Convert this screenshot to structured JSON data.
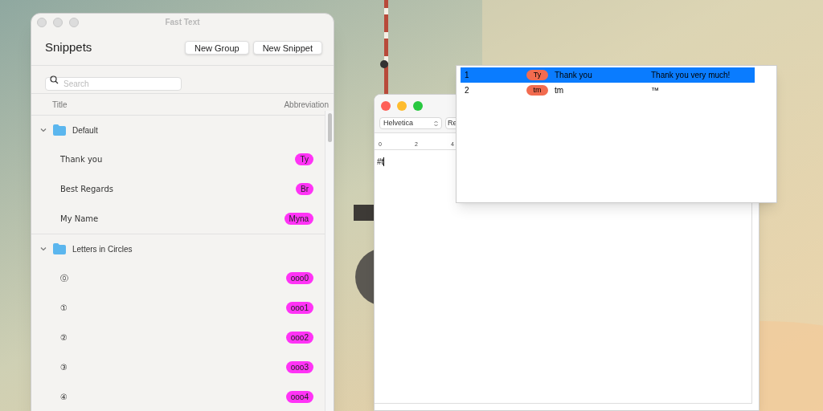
{
  "snippets_window": {
    "title": "Fast Text",
    "heading": "Snippets",
    "buttons": [
      "New Group",
      "New Snippet"
    ],
    "search": {
      "placeholder": "Search"
    },
    "columns": [
      "Title",
      "Abbreviation"
    ],
    "groups": [
      {
        "name": "Default",
        "expanded": true,
        "children": [
          {
            "title": "Thank you",
            "abbreviation": "Ty"
          },
          {
            "title": "Best Regards",
            "abbreviation": "Br"
          },
          {
            "title": "My Name",
            "abbreviation": "Myna"
          }
        ]
      },
      {
        "name": "Letters in Circles",
        "expanded": true,
        "children": [
          {
            "title": "⓪",
            "abbreviation": "ooo0"
          },
          {
            "title": "①",
            "abbreviation": "ooo1"
          },
          {
            "title": "②",
            "abbreviation": "ooo2"
          },
          {
            "title": "③",
            "abbreviation": "ooo3"
          },
          {
            "title": "④",
            "abbreviation": "ooo4"
          }
        ]
      }
    ]
  },
  "text_editor": {
    "font_family": "Helvetica",
    "font_style": "Re",
    "ruler_marks": [
      "0",
      "2",
      "4"
    ],
    "text": "#t"
  },
  "suggestions": [
    {
      "index": "1",
      "abbreviation": "Ty",
      "title": "Thank you",
      "expansion": "Thank you very much!",
      "selected": true
    },
    {
      "index": "2",
      "abbreviation": "tm",
      "title": "tm",
      "expansion": "™",
      "selected": false
    }
  ]
}
